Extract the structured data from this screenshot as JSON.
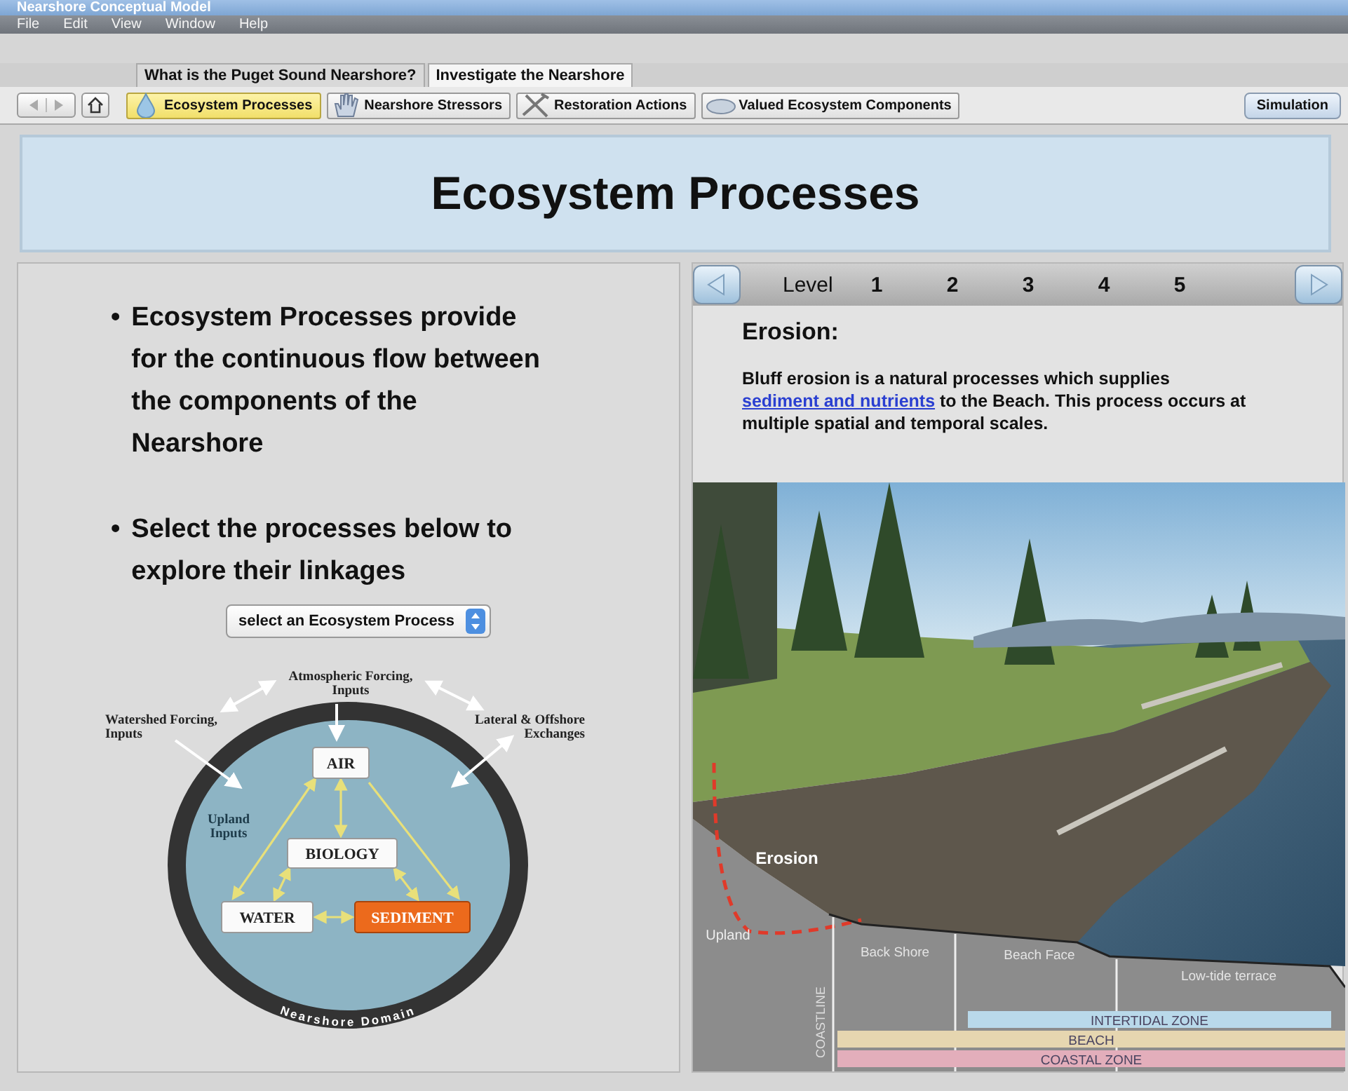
{
  "window": {
    "title": "Nearshore Conceptual Model"
  },
  "menu": [
    "File",
    "Edit",
    "View",
    "Window",
    "Help"
  ],
  "section_tabs": [
    {
      "label": "What is the Puget Sound Nearshore?",
      "selected": false
    },
    {
      "label": "Investigate the Nearshore",
      "selected": true
    }
  ],
  "toolbar": {
    "topics": [
      {
        "label": "Ecosystem Processes",
        "kind": "drop",
        "selected": true
      },
      {
        "label": "Nearshore Stressors",
        "kind": "hand",
        "selected": false
      },
      {
        "label": "Restoration Actions",
        "kind": "tools",
        "selected": false
      },
      {
        "label": "Valued Ecosystem Components",
        "kind": "disc",
        "selected": false
      }
    ],
    "simulation_button": "Simulation"
  },
  "page_title": "Ecosystem Processes",
  "bullets": [
    {
      "marker": "•",
      "text": "Ecosystem Processes provide for the continuous flow between the components of the Nearshore"
    },
    {
      "marker": "•",
      "text": "Select the processes below to explore their linkages"
    }
  ],
  "process_select": {
    "value": "select an Ecosystem Process"
  },
  "diagram": {
    "outer_labels": [
      {
        "kind": "top",
        "lines": [
          "Atmospheric Forcing,",
          "Inputs"
        ]
      },
      {
        "kind": "left",
        "lines": [
          "Watershed Forcing,",
          "Inputs"
        ]
      },
      {
        "kind": "right",
        "lines": [
          "Lateral & Offshore",
          "Exchanges"
        ]
      },
      {
        "kind": "inner",
        "lines": [
          "Upland",
          "Inputs"
        ]
      }
    ],
    "nodes": [
      {
        "label": "AIR",
        "selected": false
      },
      {
        "label": "BIOLOGY",
        "selected": false
      },
      {
        "label": "WATER",
        "selected": false
      },
      {
        "label": "SEDIMENT",
        "selected": true
      }
    ],
    "domain_label": "Nearshore Domain"
  },
  "level_nav": {
    "label": "Level",
    "levels": [
      "1",
      "2",
      "3",
      "4",
      "5"
    ]
  },
  "topic": {
    "heading": "Erosion:",
    "text_before": "Bluff erosion is a natural processes which supplies ",
    "link": "sediment and nutrients",
    "text_after": " to the Beach.  This process occurs at multiple spatial and temporal scales."
  },
  "illustration": {
    "erosion_label": "Erosion",
    "upland_label": "Upland",
    "coastline_label": "COASTLINE",
    "zone_labels": [
      "Back Shore",
      "Beach Face",
      "Low-tide terrace"
    ],
    "bands": [
      {
        "label": "INTERTIDAL ZONE",
        "color": "#b9d9ea"
      },
      {
        "label": "BEACH",
        "color": "#e6d6b0"
      },
      {
        "label": "COASTAL ZONE",
        "color": "#e3aebb"
      }
    ]
  }
}
